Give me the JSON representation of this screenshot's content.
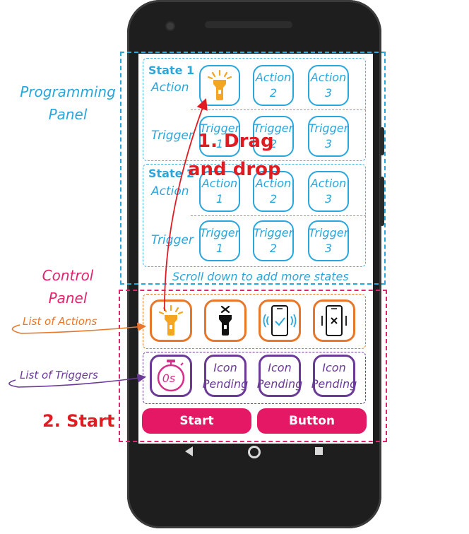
{
  "programming_panel": {
    "label_line1": "Programming",
    "label_line2": "Panel",
    "color": "#29a6dc",
    "states": [
      {
        "title": "State 1",
        "action_label": "Action",
        "trigger_label": "Trigger",
        "actions": [
          {
            "line1": "",
            "line2": "",
            "icon": "flashlight-on-icon"
          },
          {
            "line1": "Action",
            "line2": "2"
          },
          {
            "line1": "Action",
            "line2": "3"
          }
        ],
        "triggers": [
          {
            "line1": "Trigger",
            "line2": "1"
          },
          {
            "line1": "Trigger",
            "line2": "2"
          },
          {
            "line1": "Trigger",
            "line2": "3"
          }
        ]
      },
      {
        "title": "State 2",
        "action_label": "Action",
        "trigger_label": "Trigger",
        "actions": [
          {
            "line1": "Action",
            "line2": "1"
          },
          {
            "line1": "Action",
            "line2": "2"
          },
          {
            "line1": "Action",
            "line2": "3"
          }
        ],
        "triggers": [
          {
            "line1": "Trigger",
            "line2": "1"
          },
          {
            "line1": "Trigger",
            "line2": "2"
          },
          {
            "line1": "Trigger",
            "line2": "3"
          }
        ]
      }
    ],
    "scroll_hint": "Scroll down to add more states"
  },
  "control_panel": {
    "label_line1": "Control",
    "label_line2": "Panel",
    "color": "#e0256f",
    "actions_label": "List of Actions",
    "triggers_label": "List of Triggers",
    "actions": [
      {
        "icon": "flashlight-on-icon"
      },
      {
        "icon": "flashlight-off-icon"
      },
      {
        "icon": "phone-vibrate-check-icon"
      },
      {
        "icon": "phone-vibrate-cross-icon"
      }
    ],
    "triggers": [
      {
        "icon": "timer-icon",
        "timer_text": "0s"
      },
      {
        "line1": "Icon",
        "line2": "Pending"
      },
      {
        "line1": "Icon",
        "line2": "Pending"
      },
      {
        "line1": "Icon",
        "line2": "Pending"
      }
    ],
    "start_button": "Start",
    "second_button": "Button"
  },
  "annotations": {
    "drag_line1": "1. Drag",
    "drag_line2": "and drop",
    "start": "2. Start"
  },
  "colors": {
    "accent_blue": "#29a6dc",
    "accent_pink": "#e51866",
    "action_orange": "#e8772a",
    "trigger_purple": "#6b3a97",
    "annotation_red": "#e11b22",
    "flashlight_yellow": "#f4a623"
  }
}
